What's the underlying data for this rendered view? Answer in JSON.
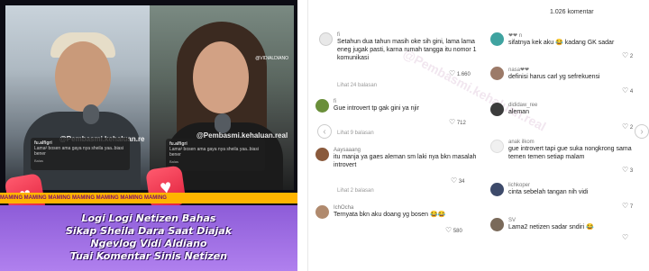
{
  "video": {
    "watermark_a": "@Pembasmi.kehaluan.re",
    "watermark_b": "@Pembasmi.kehaluan.real",
    "corner_tag": "@VIDIALDIANO",
    "mini_comment": {
      "user": "fu.alfigri",
      "text": "Lama² bosen ama gaya nya sheila yaa..biasi bener",
      "reply": "Balas"
    },
    "ribbon_text": "MAMING MAMING MAMING MAMING MAMING MAMING MAMING",
    "title_lines": [
      "Logi Logi Netizen Bahas",
      "Sikap Sheila Dara Saat Diajak",
      "Ngevlog Vidi Aldiano",
      "Tuai Komentar Sinis Netizen"
    ],
    "colors": {
      "ribbon": "#ffb400",
      "title_bg": "#a070e6",
      "heart": "#ff3e5a"
    }
  },
  "comments_panel": {
    "count_label": "1.026 komentar",
    "watermark": "@Pembasmi.kehaluan.real",
    "left": [
      {
        "user": "fi",
        "text": [
          "Setahun dua tahun masih oke sih gini, lama lama",
          "eneg jugak pasti, karna rumah tangga itu nomor 1",
          "komunikasi"
        ],
        "likes": "1.660",
        "reply": "Lihat 24 balasan"
      },
      {
        "user": "fi",
        "text": [
          "Gue introvert tp gak gini ya njir"
        ],
        "likes": "712",
        "reply": "Lihat 9 balasan"
      },
      {
        "user": "Aaysaaang",
        "text": [
          "itu manja ya gaes aleman sm laki nya bkn masalah",
          "introvert"
        ],
        "likes": "34",
        "reply": "Lihat 2 balasan"
      },
      {
        "user": "IchOcha",
        "text": [
          "Ternyata bkn aku doang yg bosen 😂😂"
        ],
        "likes": "580",
        "reply": ""
      }
    ],
    "right": [
      {
        "user": "❤❤ n",
        "text": [
          "sifatnya kek aku 😂 kadang GK sadar"
        ],
        "likes": "2"
      },
      {
        "user": "nasa❤❤",
        "text": [
          "definisi harus carl yg sefrekuensi"
        ],
        "likes": "4"
      },
      {
        "user": "dididaw_ree",
        "text": [
          "aleman"
        ],
        "likes": "2"
      },
      {
        "user": "anak ilkom",
        "text": [
          "gue introvert tapi gue suka nongkrong sama",
          "temen temen setiap malam"
        ],
        "likes": "3"
      },
      {
        "user": "lichkoper",
        "text": [
          "cinta sebelah tangan nih vidi"
        ],
        "likes": "7"
      },
      {
        "user": "SV",
        "text": [
          "Lama2 netizen sadar sndiri 😂"
        ],
        "likes": ""
      }
    ],
    "nav_left": "‹",
    "nav_right": "›"
  }
}
